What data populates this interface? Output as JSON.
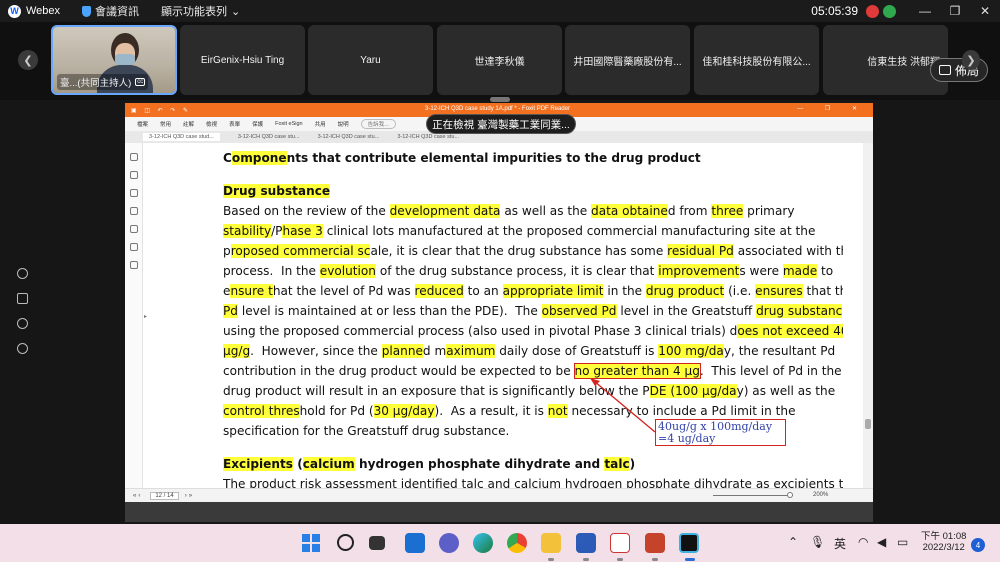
{
  "topbar": {
    "app_name": "Webex",
    "meeting_info": "會議資訊",
    "display_options": "顯示功能表列",
    "time": "05:05:39"
  },
  "participants": [
    {
      "name": "臺...(共同主持人)",
      "host": true
    },
    {
      "name": "EirGenix-Hsiu Ting"
    },
    {
      "name": "Yaru"
    },
    {
      "name": "世達李秋儀"
    },
    {
      "name": "井田國際醫藥廠股份有..."
    },
    {
      "name": "佳和桂科技股份有限公..."
    },
    {
      "name": "信東生技 洪郁翔"
    }
  ],
  "layout_button": "佈局",
  "share_banner": "正在檢視 臺灣製藥工業同業...",
  "pdf_app": {
    "title": "3-12-ICH Q3D case study 1A.pdf * - Foxit PDF Reader",
    "menu": [
      "檔案",
      "常用",
      "註解",
      "檢視",
      "表單",
      "保護",
      "Foxit eSign",
      "共用",
      "說明"
    ],
    "tell_me": "告訴我...",
    "tabs": [
      "3-12-ICH Q3D case stud...",
      "3-12-ICH Q3D case stu...",
      "3-12-ICH Q3D case stu...",
      "3-12-ICH Q3D case stu..."
    ],
    "page_indicator": "12 / 14",
    "zoom": "200%"
  },
  "document": {
    "heading": "Components that contribute elemental impurities to the drug product",
    "subheading": "Drug substance",
    "excipients_heading": "Excipients (calcium hydrogen phosphate dihydrate and talc)",
    "cut_line": "The product risk assessment identified talc and calcium hydrogen phosphate dihydrate as excipients that"
  },
  "annotation": {
    "line1": "40ug/g x 100mg/day",
    "line2": "=4 ug/day"
  },
  "taskbar": {
    "ime": "英",
    "time": "下午 01:08",
    "date": "2022/3/12",
    "notifications": "4"
  }
}
